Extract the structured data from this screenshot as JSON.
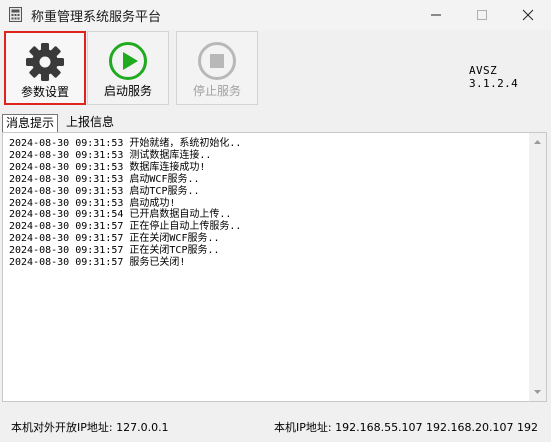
{
  "window": {
    "title": "称重管理系统服务平台",
    "controls": [
      "minimize-icon",
      "maximize-icon",
      "close-icon"
    ]
  },
  "toolbar": {
    "buttons": [
      {
        "label": "参数设置",
        "icon": "gear-icon",
        "selected": true,
        "enabled": true,
        "color": "#3a3a3a"
      },
      {
        "label": "启动服务",
        "icon": "play-icon",
        "selected": false,
        "enabled": true,
        "color": "#1faa1f"
      },
      {
        "label": "停止服务",
        "icon": "stop-icon",
        "selected": false,
        "enabled": false,
        "color": "#b8b8b8"
      }
    ],
    "selected_border_color": "#e0241c"
  },
  "version": "AVSZ 3.1.2.4",
  "tabs": [
    {
      "label": "消息提示",
      "active": true
    },
    {
      "label": "上报信息",
      "active": false
    }
  ],
  "log": [
    "2024-08-30 09:31:53 开始就绪，系统初始化..",
    "2024-08-30 09:31:53 测试数据库连接..",
    "2024-08-30 09:31:53 数据库连接成功!",
    "2024-08-30 09:31:53 启动WCF服务..",
    "2024-08-30 09:31:53 启动TCP服务..",
    "2024-08-30 09:31:53 启动成功!",
    "2024-08-30 09:31:54 已开启数据自动上传..",
    "2024-08-30 09:31:57 正在停止自动上传服务..",
    "2024-08-30 09:31:57 正在关闭WCF服务..",
    "2024-08-30 09:31:57 正在关闭TCP服务..",
    "2024-08-30 09:31:57 服务已关闭!"
  ],
  "status": {
    "public_ip": "本机对外开放IP地址: 127.0.0.1",
    "local_ips": "本机IP地址: 192.168.55.107 192.168.20.107 192"
  }
}
